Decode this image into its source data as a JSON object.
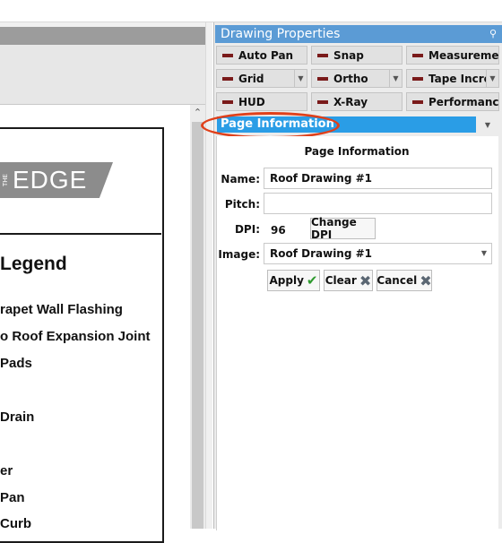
{
  "panel": {
    "title": "Drawing Properties",
    "pin_icon": "pin-icon",
    "toggles": [
      {
        "label": "Auto Pan",
        "has_dropdown": false
      },
      {
        "label": "Snap",
        "has_dropdown": false
      },
      {
        "label": "Measurement",
        "has_dropdown": false
      },
      {
        "label": "Grid",
        "has_dropdown": true
      },
      {
        "label": "Ortho",
        "has_dropdown": true
      },
      {
        "label": "Tape Increr",
        "has_dropdown": true
      },
      {
        "label": "HUD",
        "has_dropdown": false
      },
      {
        "label": "X-Ray",
        "has_dropdown": false
      },
      {
        "label": "Performance",
        "has_dropdown": false
      }
    ],
    "section_selector": "Page Information",
    "section_heading": "Page Information",
    "fields": {
      "name_label": "Name:",
      "name_value": "Roof Drawing #1",
      "pitch_label": "Pitch:",
      "pitch_value": "",
      "dpi_label": "DPI:",
      "dpi_value": "96",
      "change_dpi": "Change DPI",
      "image_label": "Image:",
      "image_value": "Roof Drawing #1"
    },
    "actions": {
      "apply": "Apply",
      "clear": "Clear",
      "cancel": "Cancel"
    },
    "colors": {
      "title_bar": "#5b9bd5",
      "selector": "#2a9de6",
      "highlight_ring": "#e0401a",
      "toggle_indicator": "#7a1a1a"
    }
  },
  "drawing": {
    "logo_small": "THE",
    "logo_text": "EDGE",
    "legend_title": "Legend",
    "legend_items": [
      "rapet Wall Flashing",
      "o Roof Expansion Joint",
      "Pads",
      "Drain",
      "er",
      "Pan",
      "Curb"
    ]
  }
}
